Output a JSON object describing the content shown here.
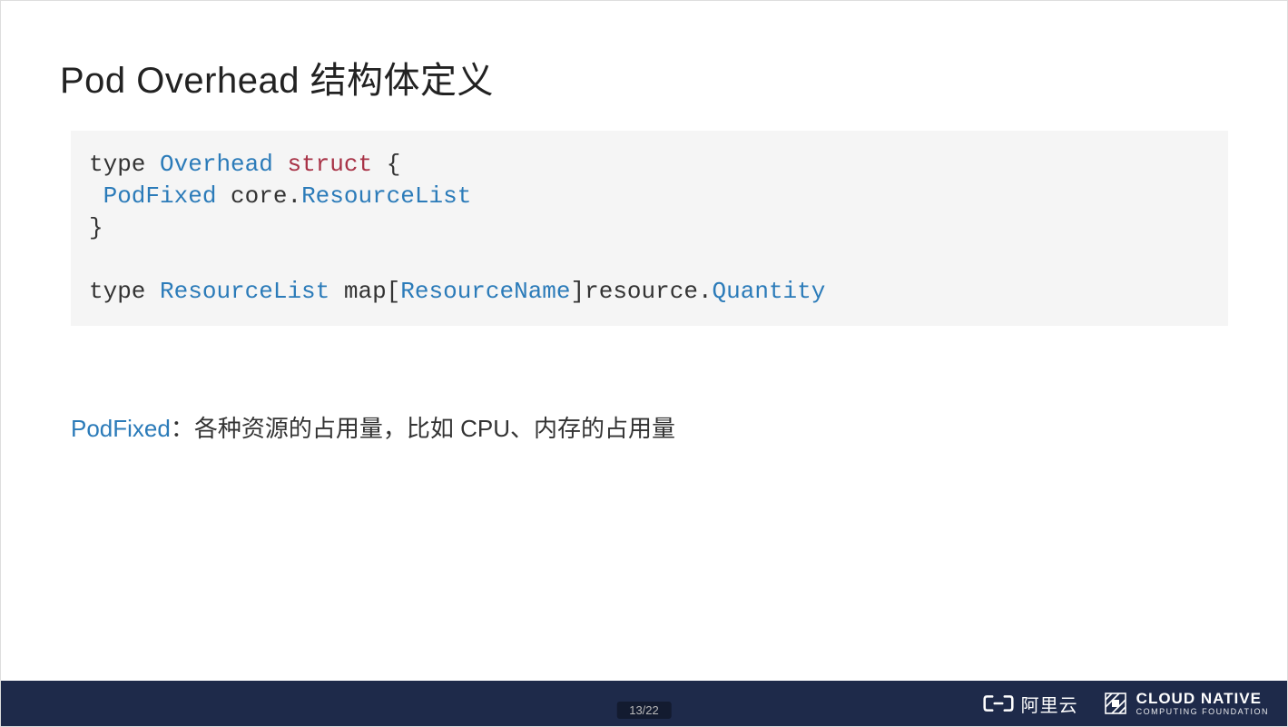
{
  "title": "Pod Overhead 结构体定义",
  "code": {
    "line1": {
      "kw": "type",
      "name": "Overhead",
      "struct": "struct",
      "open": " {"
    },
    "line2": {
      "field": " PodFixed",
      "pkg": " core.",
      "type2": "ResourceList"
    },
    "line3": "}",
    "line4": "",
    "line5": {
      "kw": "type",
      "name": "ResourceList",
      "map": " map[",
      "key": "ResourceName",
      "close": "]resource.",
      "val": "Quantity"
    }
  },
  "description": {
    "key": "PodFixed",
    "sep": "：",
    "text": "各种资源的占用量，比如 CPU、内存的占用量"
  },
  "footer": {
    "page": "13/22",
    "aliyun": "阿里云",
    "cncf_main": "CLOUD NATIVE",
    "cncf_sub": "COMPUTING FOUNDATION"
  }
}
